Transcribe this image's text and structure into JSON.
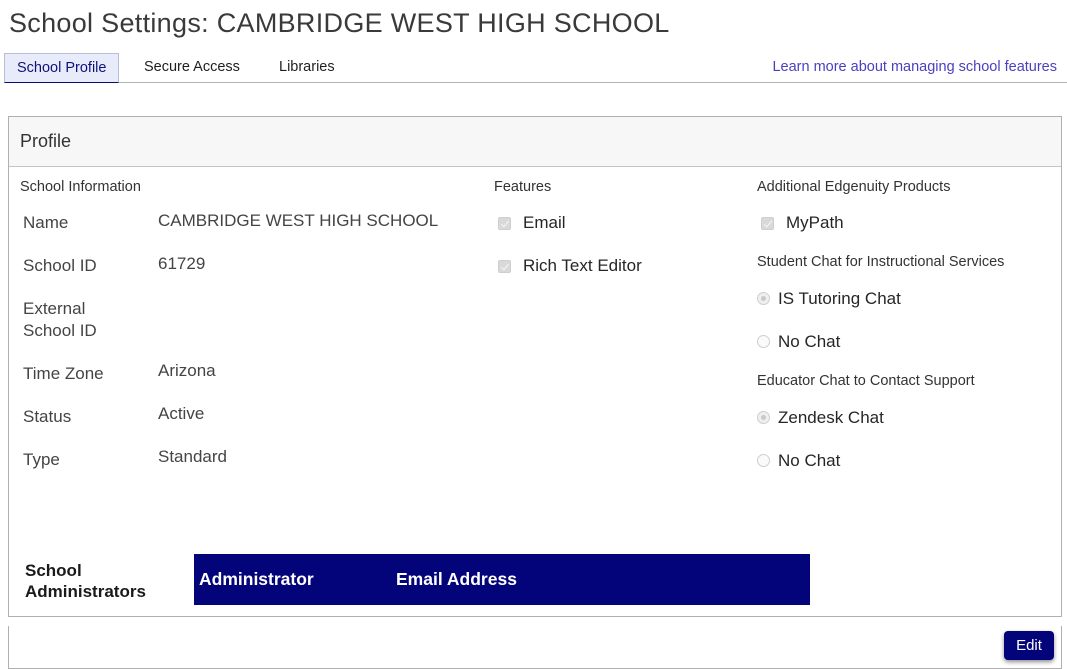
{
  "page": {
    "title": "School Settings: CAMBRIDGE WEST HIGH SCHOOL"
  },
  "tabs": [
    {
      "label": "School Profile",
      "active": true
    },
    {
      "label": "Secure Access",
      "active": false
    },
    {
      "label": "Libraries",
      "active": false
    }
  ],
  "learn_more_link": "Learn more about managing school features",
  "panel": {
    "title": "Profile",
    "school_information": {
      "heading": "School Information",
      "fields": [
        {
          "label": "Name",
          "value": "CAMBRIDGE WEST HIGH SCHOOL"
        },
        {
          "label": "School ID",
          "value": "61729"
        },
        {
          "label": "External School ID",
          "value": ""
        },
        {
          "label": "Time Zone",
          "value": "Arizona"
        },
        {
          "label": "Status",
          "value": "Active"
        },
        {
          "label": "Type",
          "value": "Standard"
        }
      ]
    },
    "features": {
      "heading": "Features",
      "items": [
        {
          "label": "Email",
          "checked": true,
          "disabled": true
        },
        {
          "label": "Rich Text Editor",
          "checked": true,
          "disabled": true
        }
      ]
    },
    "additional_products": {
      "heading": "Additional Edgenuity Products",
      "items": [
        {
          "label": "MyPath",
          "checked": true,
          "disabled": true
        }
      ]
    },
    "student_chat": {
      "heading": "Student Chat for Instructional Services",
      "options": [
        {
          "label": "IS Tutoring Chat",
          "selected": true
        },
        {
          "label": "No Chat",
          "selected": false
        }
      ]
    },
    "educator_chat": {
      "heading": "Educator Chat to Contact Support",
      "options": [
        {
          "label": "Zendesk Chat",
          "selected": true
        },
        {
          "label": "No Chat",
          "selected": false
        }
      ]
    },
    "administrators": {
      "label": "School Administrators",
      "columns": [
        "Administrator",
        "Email Address"
      ],
      "header_color": "#04047a"
    }
  },
  "actions": {
    "edit_label": "Edit"
  }
}
